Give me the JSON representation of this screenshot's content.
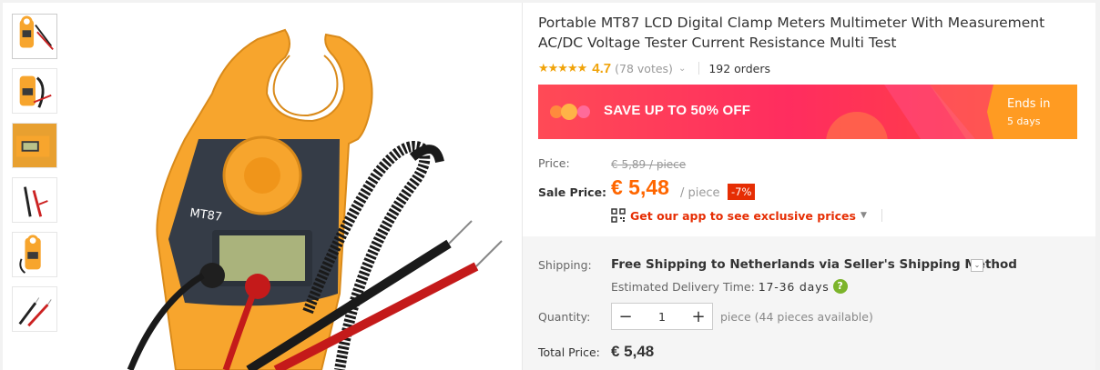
{
  "product": {
    "title": "Portable MT87 LCD Digital Clamp Meters Multimeter With Measurement AC/DC Voltage Tester Current Resistance Multi Test",
    "stars": "★★★★★",
    "rating": "4.7",
    "votes": "(78 votes)",
    "orders": "192 orders"
  },
  "banner": {
    "text": "SAVE UP TO 50% OFF",
    "ends_in": "Ends in",
    "ends_days": "5 days"
  },
  "pricing": {
    "price_label": "Price:",
    "old_price": "€ 5,89 / piece",
    "sale_label": "Sale Price:",
    "sale_price": "€ 5,48",
    "per_piece": "/ piece",
    "discount": "-7%",
    "app_link": "Get our app to see exclusive prices"
  },
  "shipping": {
    "label": "Shipping:",
    "text": "Free Shipping to Netherlands via Seller's Shipping Method",
    "est_label": "Estimated Delivery Time:",
    "est_days": "17-36 days",
    "help": "?"
  },
  "quantity": {
    "label": "Quantity:",
    "minus": "−",
    "value": "1",
    "plus": "+",
    "available": "piece (44 pieces available)"
  },
  "total": {
    "label": "Total Price:",
    "value": "€ 5,48"
  },
  "device_text": {
    "model": "MT87"
  },
  "colors": {
    "accent": "#ff6600",
    "discount": "#e62e04",
    "banner_right": "#ff9b22",
    "meter_orange": "#f7a52d"
  }
}
